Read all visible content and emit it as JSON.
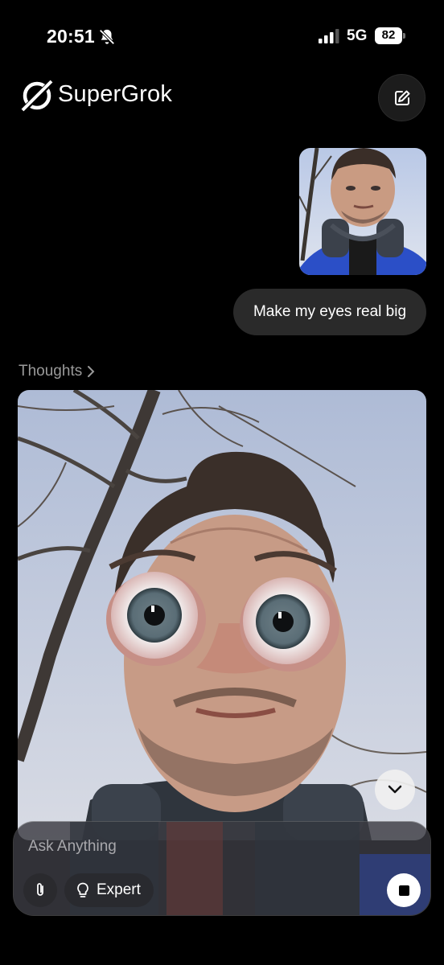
{
  "status_bar": {
    "time": "20:51",
    "network": "5G",
    "battery": "82",
    "icons": [
      "bell-slash-icon",
      "signal-icon",
      "battery-icon"
    ]
  },
  "header": {
    "brand": "SuperGrok",
    "icons": [
      "grok-logo-icon",
      "compose-icon"
    ]
  },
  "conversation": {
    "user_message": "Make my eyes real big",
    "thoughts_label": "Thoughts"
  },
  "composer": {
    "placeholder": "Ask Anything",
    "mode_label": "Expert",
    "icons": [
      "paperclip-icon",
      "lightbulb-icon",
      "stop-icon",
      "chevron-down-icon"
    ]
  },
  "colors": {
    "background": "#000000",
    "bubble": "#2a2a2a",
    "muted_text": "#9a9a9a"
  }
}
